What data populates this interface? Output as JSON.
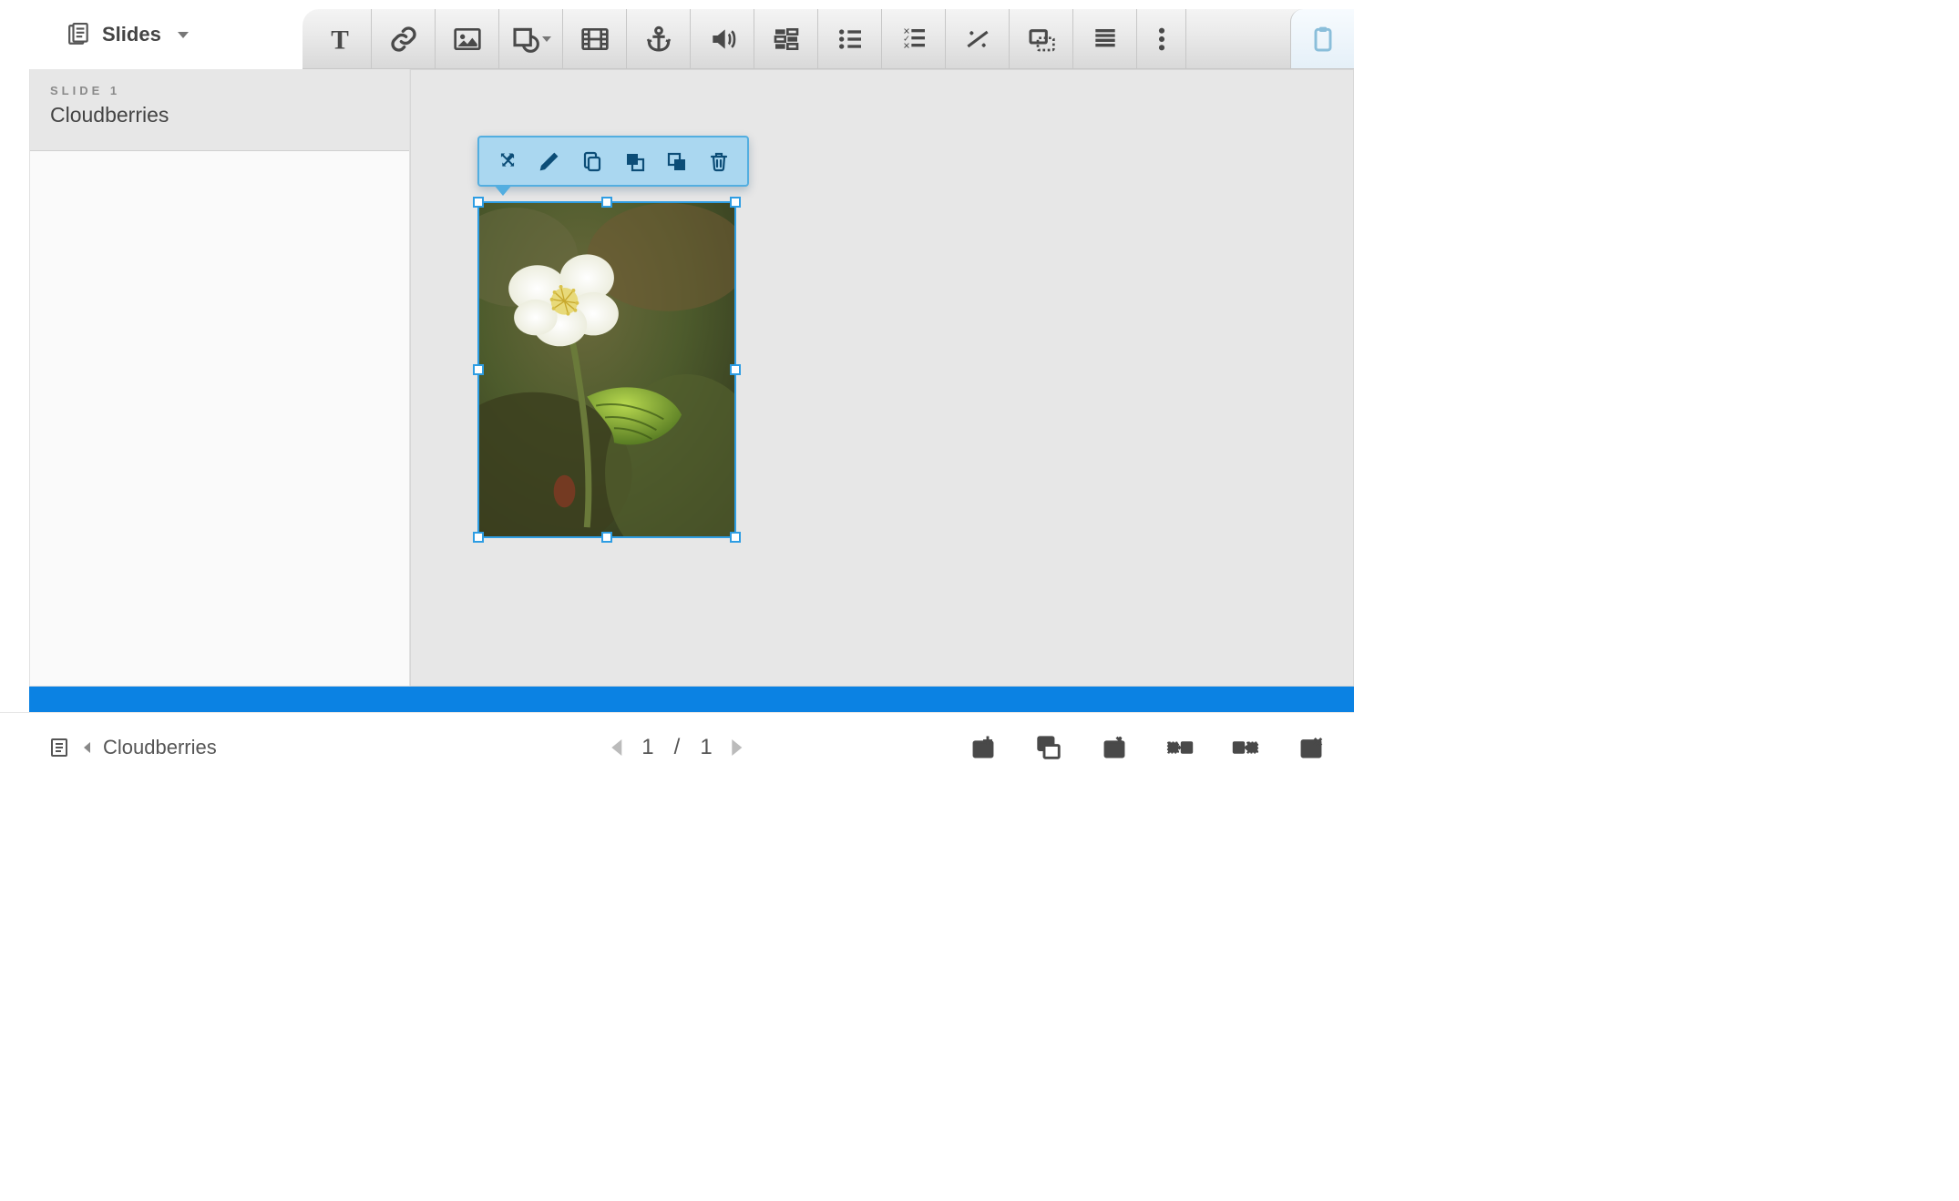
{
  "header": {
    "slides_menu_label": "Slides"
  },
  "toolbar": {
    "items": [
      {
        "name": "text-tool",
        "icon": "text"
      },
      {
        "name": "link-tool",
        "icon": "link"
      },
      {
        "name": "image-tool",
        "icon": "image"
      },
      {
        "name": "shape-tool",
        "icon": "shape",
        "has_caret": true
      },
      {
        "name": "video-tool",
        "icon": "video"
      },
      {
        "name": "anchor-tool",
        "icon": "anchor"
      },
      {
        "name": "audio-tool",
        "icon": "audio"
      },
      {
        "name": "layout-tool",
        "icon": "sliders"
      },
      {
        "name": "bullet-list-tool",
        "icon": "bullet"
      },
      {
        "name": "check-list-tool",
        "icon": "checklist"
      },
      {
        "name": "fraction-tool",
        "icon": "fraction"
      },
      {
        "name": "frame-tool",
        "icon": "frame"
      },
      {
        "name": "outline-tool",
        "icon": "outline"
      },
      {
        "name": "more-tool",
        "icon": "more"
      }
    ],
    "clipboard": {
      "name": "clipboard-tool",
      "icon": "clipboard"
    }
  },
  "sidebar": {
    "slides": [
      {
        "eyebrow": "SLIDE 1",
        "title": "Cloudberries"
      }
    ]
  },
  "stage": {
    "selected_object": {
      "type": "image",
      "alt": "cloudberry-flower-photo"
    }
  },
  "popup": {
    "items": [
      {
        "name": "move-action",
        "icon": "move"
      },
      {
        "name": "edit-action",
        "icon": "pencil"
      },
      {
        "name": "copy-action",
        "icon": "copy"
      },
      {
        "name": "front-action",
        "icon": "bring-front"
      },
      {
        "name": "back-action",
        "icon": "send-back"
      },
      {
        "name": "delete-action",
        "icon": "trash"
      }
    ]
  },
  "footer": {
    "breadcrumb_title": "Cloudberries",
    "page_current": "1",
    "page_separator": "/",
    "page_total": "1",
    "actions": [
      {
        "name": "add-slide",
        "icon": "add-slide"
      },
      {
        "name": "duplicate-slide",
        "icon": "dup-slide"
      },
      {
        "name": "slide-settings",
        "icon": "settings-slide"
      },
      {
        "name": "move-slide-left",
        "icon": "move-left"
      },
      {
        "name": "move-slide-right",
        "icon": "move-right"
      },
      {
        "name": "delete-slide",
        "icon": "del-slide"
      }
    ]
  },
  "colors": {
    "accent": "#1a8cda",
    "selection": "#2e9de3",
    "footer_strip": "#0b82e3"
  }
}
